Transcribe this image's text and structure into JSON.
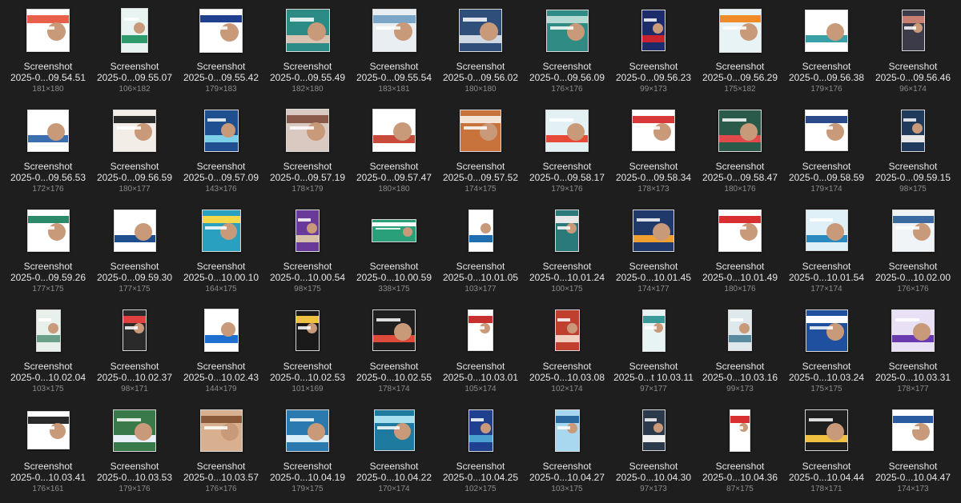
{
  "files": [
    {
      "l1": "Screenshot",
      "l2": "2025-0...09.54.51",
      "dims": "181×180",
      "tw": 54,
      "th": 54,
      "bg": "#ffffff",
      "ac": "#e8604c"
    },
    {
      "l1": "Screenshot",
      "l2": "2025-0...09.55.07",
      "dims": "106×182",
      "tw": 34,
      "th": 56,
      "bg": "#e8f4f2",
      "ac": "#2f9b6d"
    },
    {
      "l1": "Screenshot",
      "l2": "2025-0...09.55.42",
      "dims": "179×183",
      "tw": 54,
      "th": 55,
      "bg": "#ffffff",
      "ac": "#1f3f8f"
    },
    {
      "l1": "Screenshot",
      "l2": "2025-0...09.55.49",
      "dims": "182×180",
      "tw": 55,
      "th": 54,
      "bg": "#2d8b86",
      "ac": "#d8c2b0"
    },
    {
      "l1": "Screenshot",
      "l2": "2025-0...09.55.54",
      "dims": "183×181",
      "tw": 55,
      "th": 54,
      "bg": "#e9eef2",
      "ac": "#7ca6c8"
    },
    {
      "l1": "Screenshot",
      "l2": "2025-0...09.56.02",
      "dims": "180×180",
      "tw": 54,
      "th": 54,
      "bg": "#2f4f7a",
      "ac": "#cfd9e4"
    },
    {
      "l1": "Screenshot",
      "l2": "2025-0...09.56.09",
      "dims": "176×176",
      "tw": 53,
      "th": 53,
      "bg": "#2f8b83",
      "ac": "#b5d9d3"
    },
    {
      "l1": "Screenshot",
      "l2": "2025-0...09.56.23",
      "dims": "99×173",
      "tw": 30,
      "th": 52,
      "bg": "#1c2c6a",
      "ac": "#c8242d"
    },
    {
      "l1": "Screenshot",
      "l2": "2025-0...09.56.29",
      "dims": "175×182",
      "tw": 53,
      "th": 55,
      "bg": "#e8f3f5",
      "ac": "#f08b2a"
    },
    {
      "l1": "Screenshot",
      "l2": "2025-0...09.56.38",
      "dims": "179×176",
      "tw": 54,
      "th": 53,
      "bg": "#ffffff",
      "ac": "#3aa0a8"
    },
    {
      "l1": "Screenshot",
      "l2": "2025-0...09.56.46",
      "dims": "96×174",
      "tw": 29,
      "th": 52,
      "bg": "#3b3b4a",
      "ac": "#c88070"
    },
    {
      "l1": "Screenshot",
      "l2": "2025-0...09.56.53",
      "dims": "172×176",
      "tw": 52,
      "th": 53,
      "bg": "#ffffff",
      "ac": "#3c6fb0"
    },
    {
      "l1": "Screenshot",
      "l2": "2025-0...09.56.59",
      "dims": "180×177",
      "tw": 54,
      "th": 53,
      "bg": "#f2ede6",
      "ac": "#2a2a2a"
    },
    {
      "l1": "Screenshot",
      "l2": "2025-0...09.57.09",
      "dims": "143×176",
      "tw": 43,
      "th": 53,
      "bg": "#1f4f8f",
      "ac": "#7bd0e8"
    },
    {
      "l1": "Screenshot",
      "l2": "2025-0...09.57.19",
      "dims": "178×179",
      "tw": 54,
      "th": 54,
      "bg": "#d9c9c0",
      "ac": "#8a5a4a"
    },
    {
      "l1": "Screenshot",
      "l2": "2025-0...09.57.47",
      "dims": "180×180",
      "tw": 54,
      "th": 54,
      "bg": "#ffffff",
      "ac": "#c84a3a"
    },
    {
      "l1": "Screenshot",
      "l2": "2025-0...09.57.52",
      "dims": "174×175",
      "tw": 52,
      "th": 53,
      "bg": "#c8733c",
      "ac": "#f2e4d6"
    },
    {
      "l1": "Screenshot",
      "l2": "2025-0...09.58.17",
      "dims": "179×176",
      "tw": 54,
      "th": 53,
      "bg": "#e4f1f4",
      "ac": "#e84a3a"
    },
    {
      "l1": "Screenshot",
      "l2": "2025-0...09.58.34",
      "dims": "178×173",
      "tw": 54,
      "th": 52,
      "bg": "#ffffff",
      "ac": "#d83a3a"
    },
    {
      "l1": "Screenshot",
      "l2": "2025-0...09.58.47",
      "dims": "180×176",
      "tw": 54,
      "th": 53,
      "bg": "#2a5a4a",
      "ac": "#e04a4a"
    },
    {
      "l1": "Screenshot",
      "l2": "2025-0...09.58.59",
      "dims": "179×174",
      "tw": 54,
      "th": 52,
      "bg": "#ffffff",
      "ac": "#2a4a8a"
    },
    {
      "l1": "Screenshot",
      "l2": "2025-0...09.59.15",
      "dims": "98×175",
      "tw": 30,
      "th": 53,
      "bg": "#1f3a5a",
      "ac": "#e8e8e8"
    },
    {
      "l1": "Screenshot",
      "l2": "2025-0...09.59.26",
      "dims": "177×175",
      "tw": 53,
      "th": 53,
      "bg": "#ffffff",
      "ac": "#2a8a6a"
    },
    {
      "l1": "Screenshot",
      "l2": "2025-0...09.59.30",
      "dims": "177×175",
      "tw": 53,
      "th": 53,
      "bg": "#ffffff",
      "ac": "#1f4f8f"
    },
    {
      "l1": "Screenshot",
      "l2": "2025-0...10.00.10",
      "dims": "164×175",
      "tw": 49,
      "th": 53,
      "bg": "#2aa0c0",
      "ac": "#f2d84a"
    },
    {
      "l1": "Screenshot",
      "l2": "2025-0...10.00.54",
      "dims": "98×175",
      "tw": 30,
      "th": 53,
      "bg": "#6a3a9a",
      "ac": "#d8c0a8"
    },
    {
      "l1": "Screenshot",
      "l2": "2025-0...10.00.59",
      "dims": "338×175",
      "tw": 56,
      "th": 29,
      "bg": "#2aa07a",
      "ac": "#ffffff"
    },
    {
      "l1": "Screenshot",
      "l2": "2025-0...10.01.05",
      "dims": "103×177",
      "tw": 31,
      "th": 53,
      "bg": "#ffffff",
      "ac": "#1f6fb0"
    },
    {
      "l1": "Screenshot",
      "l2": "2025-0...10.01.24",
      "dims": "100×175",
      "tw": 30,
      "th": 53,
      "bg": "#2a7a7a",
      "ac": "#e8e8e8"
    },
    {
      "l1": "Screenshot",
      "l2": "2025-0...10.01.45",
      "dims": "174×177",
      "tw": 52,
      "th": 53,
      "bg": "#1f3a6a",
      "ac": "#f0a030"
    },
    {
      "l1": "Screenshot",
      "l2": "2025-0...10.01.49",
      "dims": "180×176",
      "tw": 54,
      "th": 53,
      "bg": "#ffffff",
      "ac": "#d83030"
    },
    {
      "l1": "Screenshot",
      "l2": "2025-0...10.01.54",
      "dims": "177×174",
      "tw": 53,
      "th": 52,
      "bg": "#e0f0f8",
      "ac": "#2a8ac0"
    },
    {
      "l1": "Screenshot",
      "l2": "2025-0...10.02.00",
      "dims": "176×176",
      "tw": 53,
      "th": 53,
      "bg": "#f0f4f6",
      "ac": "#3a6aa0"
    },
    {
      "l1": "Screenshot",
      "l2": "2025-0...10.02.04",
      "dims": "103×175",
      "tw": 31,
      "th": 53,
      "bg": "#e8f0ec",
      "ac": "#6aa08a"
    },
    {
      "l1": "Screenshot",
      "l2": "2025-0...10.02.37",
      "dims": "98×171",
      "tw": 30,
      "th": 52,
      "bg": "#2a2a2a",
      "ac": "#e04040"
    },
    {
      "l1": "Screenshot",
      "l2": "2025-0...10.02.43",
      "dims": "144×179",
      "tw": 43,
      "th": 54,
      "bg": "#ffffff",
      "ac": "#1f6fd0"
    },
    {
      "l1": "Screenshot",
      "l2": "2025-0...10.02.53",
      "dims": "101×169",
      "tw": 30,
      "th": 51,
      "bg": "#1a1a1a",
      "ac": "#f0c040"
    },
    {
      "l1": "Screenshot",
      "l2": "2025-0...10.02.55",
      "dims": "178×174",
      "tw": 54,
      "th": 52,
      "bg": "#1f1f1f",
      "ac": "#e04a3a"
    },
    {
      "l1": "Screenshot",
      "l2": "2025-0...10.03.01",
      "dims": "105×174",
      "tw": 32,
      "th": 52,
      "bg": "#ffffff",
      "ac": "#c83030"
    },
    {
      "l1": "Screenshot",
      "l2": "2025-0...10.03.08",
      "dims": "102×174",
      "tw": 31,
      "th": 52,
      "bg": "#c04030",
      "ac": "#f0d0c0"
    },
    {
      "l1": "Screenshot",
      "l2": "2025-0...t 10.03.11",
      "dims": "97×177",
      "tw": 29,
      "th": 53,
      "bg": "#e8f4f4",
      "ac": "#3a9a9a"
    },
    {
      "l1": "Screenshot",
      "l2": "2025-0...10.03.16",
      "dims": "99×173",
      "tw": 30,
      "th": 52,
      "bg": "#dfe8ec",
      "ac": "#5a8aa0"
    },
    {
      "l1": "Screenshot",
      "l2": "2025-0...10.03.24",
      "dims": "175×175",
      "tw": 53,
      "th": 53,
      "bg": "#1f4f9f",
      "ac": "#ffffff"
    },
    {
      "l1": "Screenshot",
      "l2": "2025-0...10.03.31",
      "dims": "178×177",
      "tw": 54,
      "th": 53,
      "bg": "#e8e0f4",
      "ac": "#6a3ab0"
    },
    {
      "l1": "Screenshot",
      "l2": "2025-0...10.03.41",
      "dims": "176×161",
      "tw": 53,
      "th": 48,
      "bg": "#ffffff",
      "ac": "#2a2a2a"
    },
    {
      "l1": "Screenshot",
      "l2": "2025-0...10.03.53",
      "dims": "179×176",
      "tw": 54,
      "th": 53,
      "bg": "#3a7a4a",
      "ac": "#e8f0f8"
    },
    {
      "l1": "Screenshot",
      "l2": "2025-0...10.03.57",
      "dims": "176×176",
      "tw": 53,
      "th": 53,
      "bg": "#d8b090",
      "ac": "#8a5a3a"
    },
    {
      "l1": "Screenshot",
      "l2": "2025-0...10.04.19",
      "dims": "179×175",
      "tw": 54,
      "th": 53,
      "bg": "#2a7ab0",
      "ac": "#d8eef8"
    },
    {
      "l1": "Screenshot",
      "l2": "2025-0...10.04.22",
      "dims": "170×174",
      "tw": 51,
      "th": 52,
      "bg": "#1f7aa0",
      "ac": "#a8e0f0"
    },
    {
      "l1": "Screenshot",
      "l2": "2025-0...10.04.25",
      "dims": "102×175",
      "tw": 31,
      "th": 53,
      "bg": "#1f3f8f",
      "ac": "#4aa0d0"
    },
    {
      "l1": "Screenshot",
      "l2": "2025-0...10.04.27",
      "dims": "103×175",
      "tw": 31,
      "th": 53,
      "bg": "#a8d8f0",
      "ac": "#2a6aa0"
    },
    {
      "l1": "Screenshot",
      "l2": "2025-0...10.04.30",
      "dims": "97×173",
      "tw": 29,
      "th": 52,
      "bg": "#2a3a4a",
      "ac": "#f0f0f0"
    },
    {
      "l1": "Screenshot",
      "l2": "2025-0...10.04.36",
      "dims": "87×175",
      "tw": 26,
      "th": 53,
      "bg": "#ffffff",
      "ac": "#d83030"
    },
    {
      "l1": "Screenshot",
      "l2": "2025-0...10.04.44",
      "dims": "178×171",
      "tw": 54,
      "th": 52,
      "bg": "#1f1f1f",
      "ac": "#f0c040"
    },
    {
      "l1": "Screenshot",
      "l2": "2025-0...10.04.47",
      "dims": "174×173",
      "tw": 52,
      "th": 52,
      "bg": "#ffffff",
      "ac": "#2a5aa0"
    }
  ]
}
